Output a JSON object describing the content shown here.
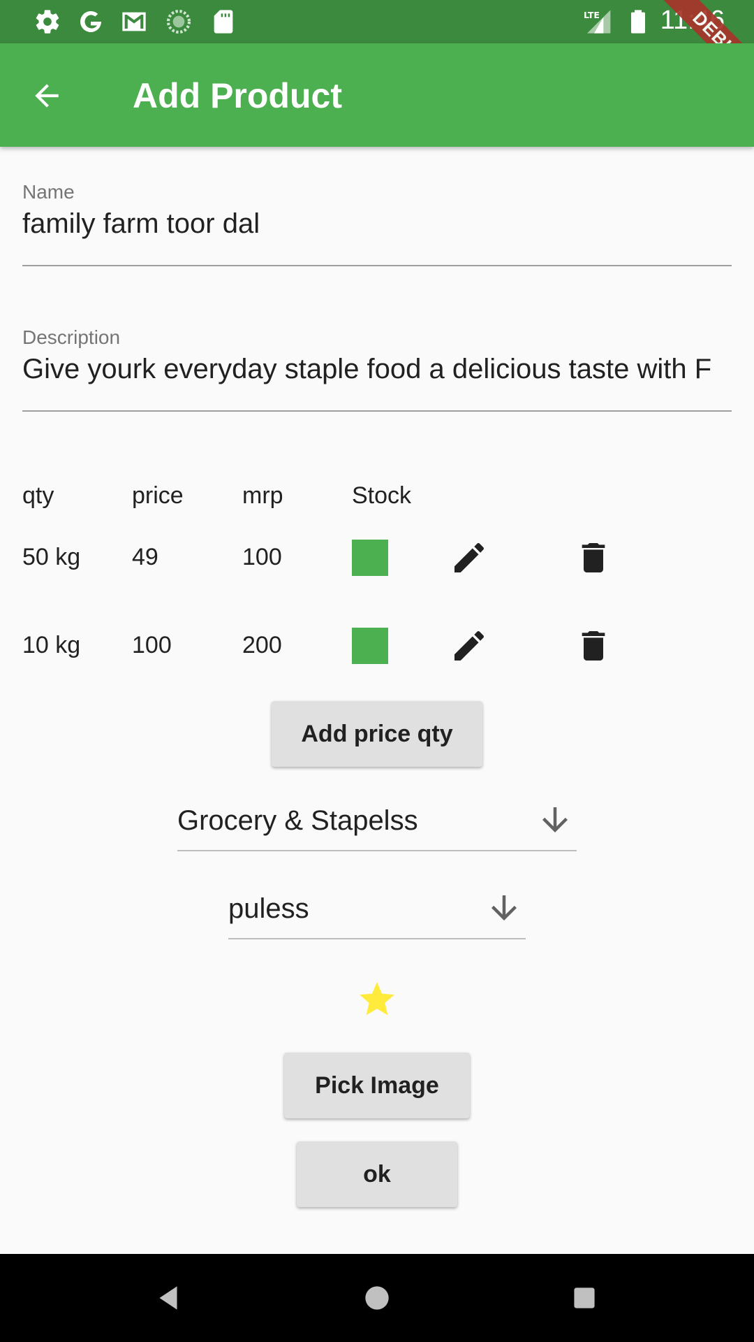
{
  "status_bar": {
    "time": "11:46",
    "icons": [
      "settings-icon",
      "google-icon",
      "gmail-icon",
      "sync-icon",
      "sd-card-icon",
      "lte-signal-icon",
      "battery-icon"
    ]
  },
  "debug_banner": "DEBUG",
  "app_bar": {
    "title": "Add Product",
    "back_icon": "arrow-back-icon",
    "color": "#4caf50"
  },
  "form": {
    "name": {
      "label": "Name",
      "value": "family farm toor dal"
    },
    "description": {
      "label": "Description",
      "value": "Give yourk everyday staple food a delicious taste with F"
    }
  },
  "price_table": {
    "headers": [
      "qty",
      "price",
      "mrp",
      "Stock"
    ],
    "rows": [
      {
        "qty": "50 kg",
        "price": "49",
        "mrp": "100",
        "in_stock": true
      },
      {
        "qty": "10 kg",
        "price": "100",
        "mrp": "200",
        "in_stock": true
      }
    ],
    "stock_color": "#4caf50"
  },
  "add_price_qty_button": "Add price qty",
  "category_dropdown": {
    "value": "Grocery & Stapelss"
  },
  "subcategory_dropdown": {
    "value": "puless"
  },
  "featured_star": {
    "color": "#ffeb3b"
  },
  "pick_image_button": "Pick Image",
  "ok_button": "ok",
  "nav_bar": {
    "icons": [
      "back-triangle-icon",
      "home-circle-icon",
      "recents-square-icon"
    ]
  }
}
